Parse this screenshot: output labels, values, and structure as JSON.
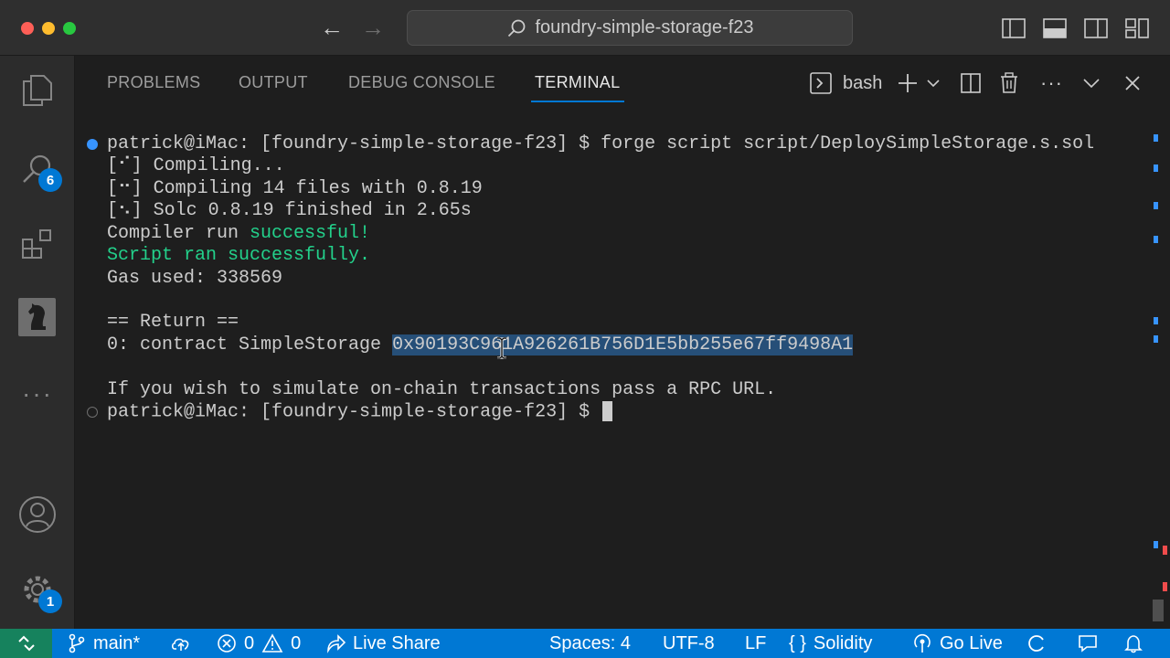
{
  "window": {
    "title": "foundry-simple-storage-f23"
  },
  "panel": {
    "tabs": [
      {
        "label": "PROBLEMS"
      },
      {
        "label": "OUTPUT"
      },
      {
        "label": "DEBUG CONSOLE"
      },
      {
        "label": "TERMINAL"
      }
    ],
    "active_tab": "TERMINAL",
    "shell": "bash"
  },
  "activity": {
    "search_badge": "6",
    "settings_badge": "1"
  },
  "terminal": {
    "prompt": "patrick@iMac: [foundry-simple-storage-f23] $",
    "command": " forge script script/DeploySimpleStorage.s.sol",
    "lines": {
      "l1": "[⠊] Compiling...",
      "l2": "[⠒] Compiling 14 files with 0.8.19",
      "l3": "[⠢] Solc 0.8.19 finished in 2.65s",
      "l4_prefix": "Compiler run ",
      "l4_success": "successful!",
      "l5": "Script ran successfully.",
      "l6": "Gas used: 338569",
      "l7": "== Return ==",
      "l8_prefix": "0: contract SimpleStorage ",
      "l8_address": "0x90193C961A926261B756D1E5bb255e67ff9498A1",
      "l9": "If you wish to simulate on-chain transactions pass a RPC URL."
    },
    "final_prompt": "patrick@iMac: [foundry-simple-storage-f23] $ "
  },
  "statusbar": {
    "branch": "main*",
    "errors": "0",
    "warnings": "0",
    "live_share": "Live Share",
    "spaces": "Spaces: 4",
    "encoding": "UTF-8",
    "eol": "LF",
    "language": "Solidity",
    "go_live": "Go Live"
  },
  "colors": {
    "accent": "#0078d4",
    "terminal_green": "#23d18b",
    "selection": "#264f78",
    "remote": "#16825d"
  }
}
